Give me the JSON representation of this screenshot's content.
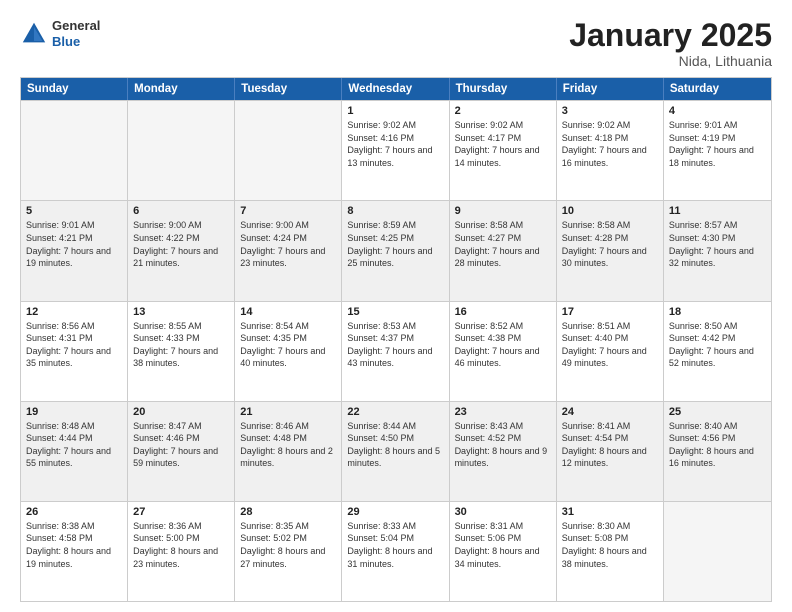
{
  "header": {
    "logo": {
      "general": "General",
      "blue": "Blue"
    },
    "title": "January 2025",
    "location": "Nida, Lithuania"
  },
  "calendar": {
    "days_of_week": [
      "Sunday",
      "Monday",
      "Tuesday",
      "Wednesday",
      "Thursday",
      "Friday",
      "Saturday"
    ],
    "rows": [
      [
        {
          "day": "",
          "empty": true
        },
        {
          "day": "",
          "empty": true
        },
        {
          "day": "",
          "empty": true
        },
        {
          "day": "1",
          "sunrise": "9:02 AM",
          "sunset": "4:16 PM",
          "daylight": "7 hours and 13 minutes."
        },
        {
          "day": "2",
          "sunrise": "9:02 AM",
          "sunset": "4:17 PM",
          "daylight": "7 hours and 14 minutes."
        },
        {
          "day": "3",
          "sunrise": "9:02 AM",
          "sunset": "4:18 PM",
          "daylight": "7 hours and 16 minutes."
        },
        {
          "day": "4",
          "sunrise": "9:01 AM",
          "sunset": "4:19 PM",
          "daylight": "7 hours and 18 minutes."
        }
      ],
      [
        {
          "day": "5",
          "sunrise": "9:01 AM",
          "sunset": "4:21 PM",
          "daylight": "7 hours and 19 minutes.",
          "shaded": true
        },
        {
          "day": "6",
          "sunrise": "9:00 AM",
          "sunset": "4:22 PM",
          "daylight": "7 hours and 21 minutes.",
          "shaded": true
        },
        {
          "day": "7",
          "sunrise": "9:00 AM",
          "sunset": "4:24 PM",
          "daylight": "7 hours and 23 minutes.",
          "shaded": true
        },
        {
          "day": "8",
          "sunrise": "8:59 AM",
          "sunset": "4:25 PM",
          "daylight": "7 hours and 25 minutes.",
          "shaded": true
        },
        {
          "day": "9",
          "sunrise": "8:58 AM",
          "sunset": "4:27 PM",
          "daylight": "7 hours and 28 minutes.",
          "shaded": true
        },
        {
          "day": "10",
          "sunrise": "8:58 AM",
          "sunset": "4:28 PM",
          "daylight": "7 hours and 30 minutes.",
          "shaded": true
        },
        {
          "day": "11",
          "sunrise": "8:57 AM",
          "sunset": "4:30 PM",
          "daylight": "7 hours and 32 minutes.",
          "shaded": true
        }
      ],
      [
        {
          "day": "12",
          "sunrise": "8:56 AM",
          "sunset": "4:31 PM",
          "daylight": "7 hours and 35 minutes."
        },
        {
          "day": "13",
          "sunrise": "8:55 AM",
          "sunset": "4:33 PM",
          "daylight": "7 hours and 38 minutes."
        },
        {
          "day": "14",
          "sunrise": "8:54 AM",
          "sunset": "4:35 PM",
          "daylight": "7 hours and 40 minutes."
        },
        {
          "day": "15",
          "sunrise": "8:53 AM",
          "sunset": "4:37 PM",
          "daylight": "7 hours and 43 minutes."
        },
        {
          "day": "16",
          "sunrise": "8:52 AM",
          "sunset": "4:38 PM",
          "daylight": "7 hours and 46 minutes."
        },
        {
          "day": "17",
          "sunrise": "8:51 AM",
          "sunset": "4:40 PM",
          "daylight": "7 hours and 49 minutes."
        },
        {
          "day": "18",
          "sunrise": "8:50 AM",
          "sunset": "4:42 PM",
          "daylight": "7 hours and 52 minutes."
        }
      ],
      [
        {
          "day": "19",
          "sunrise": "8:48 AM",
          "sunset": "4:44 PM",
          "daylight": "7 hours and 55 minutes.",
          "shaded": true
        },
        {
          "day": "20",
          "sunrise": "8:47 AM",
          "sunset": "4:46 PM",
          "daylight": "7 hours and 59 minutes.",
          "shaded": true
        },
        {
          "day": "21",
          "sunrise": "8:46 AM",
          "sunset": "4:48 PM",
          "daylight": "8 hours and 2 minutes.",
          "shaded": true
        },
        {
          "day": "22",
          "sunrise": "8:44 AM",
          "sunset": "4:50 PM",
          "daylight": "8 hours and 5 minutes.",
          "shaded": true
        },
        {
          "day": "23",
          "sunrise": "8:43 AM",
          "sunset": "4:52 PM",
          "daylight": "8 hours and 9 minutes.",
          "shaded": true
        },
        {
          "day": "24",
          "sunrise": "8:41 AM",
          "sunset": "4:54 PM",
          "daylight": "8 hours and 12 minutes.",
          "shaded": true
        },
        {
          "day": "25",
          "sunrise": "8:40 AM",
          "sunset": "4:56 PM",
          "daylight": "8 hours and 16 minutes.",
          "shaded": true
        }
      ],
      [
        {
          "day": "26",
          "sunrise": "8:38 AM",
          "sunset": "4:58 PM",
          "daylight": "8 hours and 19 minutes."
        },
        {
          "day": "27",
          "sunrise": "8:36 AM",
          "sunset": "5:00 PM",
          "daylight": "8 hours and 23 minutes."
        },
        {
          "day": "28",
          "sunrise": "8:35 AM",
          "sunset": "5:02 PM",
          "daylight": "8 hours and 27 minutes."
        },
        {
          "day": "29",
          "sunrise": "8:33 AM",
          "sunset": "5:04 PM",
          "daylight": "8 hours and 31 minutes."
        },
        {
          "day": "30",
          "sunrise": "8:31 AM",
          "sunset": "5:06 PM",
          "daylight": "8 hours and 34 minutes."
        },
        {
          "day": "31",
          "sunrise": "8:30 AM",
          "sunset": "5:08 PM",
          "daylight": "8 hours and 38 minutes."
        },
        {
          "day": "",
          "empty": true
        }
      ]
    ]
  }
}
